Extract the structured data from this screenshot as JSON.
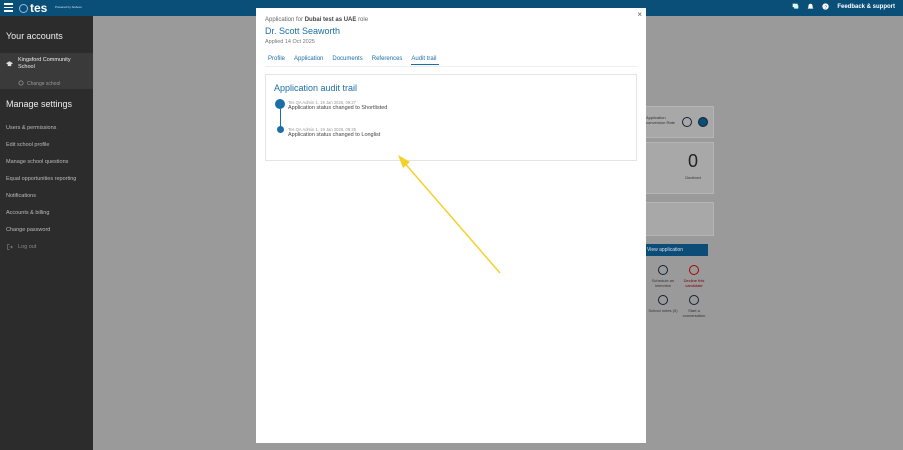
{
  "topbar": {
    "logo_text": "tes",
    "powered_by": "Powered by Sodexo",
    "feedback_label": "Feedback & support"
  },
  "sidebar": {
    "accounts_heading": "Your accounts",
    "school_name": "Kingsford Community School",
    "change_school": "Change school",
    "settings_heading": "Manage settings",
    "items": [
      {
        "label": "Users & permissions"
      },
      {
        "label": "Edit school profile"
      },
      {
        "label": "Manage school questions"
      },
      {
        "label": "Equal opportunities reporting"
      },
      {
        "label": "Notifications"
      },
      {
        "label": "Accounts & billing"
      },
      {
        "label": "Change password"
      },
      {
        "label": "Log out"
      }
    ]
  },
  "background": {
    "stat_value": "0",
    "stat_label": "Declined",
    "view_application": "View application",
    "conversion_text": "Application conversion Rate",
    "actions": [
      {
        "label": "Schedule an interview"
      },
      {
        "label": "Decline this candidate"
      },
      {
        "label": "School notes (0)"
      },
      {
        "label": "Start a conversation"
      }
    ]
  },
  "modal": {
    "subtitle_prefix": "Application for",
    "role_name": "Dubai test as UAE",
    "subtitle_suffix": "role",
    "candidate_name": "Dr. Scott Seaworth",
    "applied": "Applied 14 Oct 2025",
    "close": "×",
    "tabs": [
      {
        "label": "Profile"
      },
      {
        "label": "Application"
      },
      {
        "label": "Documents"
      },
      {
        "label": "References"
      },
      {
        "label": "Audit trail"
      }
    ],
    "active_tab": "Audit trail",
    "audit": {
      "title": "Application audit trail",
      "events": [
        {
          "meta": "Tes QA Admin 1, 19 Jan 2026, 09:27",
          "text": "Application status changed to Shortlisted"
        },
        {
          "meta": "Tes QA Admin 1, 19 Jan 2026, 09:25",
          "text": "Application status changed to Longlist"
        }
      ]
    }
  },
  "colors": {
    "brand": "#0a4f78",
    "link": "#1b6ea8",
    "annotation_arrow": "#f4d12a"
  }
}
